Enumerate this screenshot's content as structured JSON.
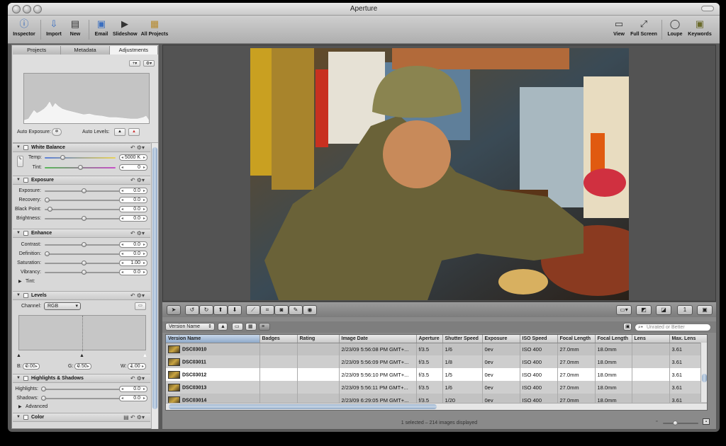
{
  "window": {
    "title": "Aperture"
  },
  "toolbar": {
    "inspector": "Inspector",
    "import": "Import",
    "new": "New",
    "email": "Email",
    "slideshow": "Slideshow",
    "all_projects": "All Projects",
    "view": "View",
    "full_screen": "Full Screen",
    "loupe": "Loupe",
    "keywords": "Keywords"
  },
  "inspector": {
    "tabs": [
      "Projects",
      "Metadata",
      "Adjustments"
    ],
    "active_tab": "Adjustments",
    "auto_exposure": "Auto Exposure:",
    "auto_levels": "Auto Levels:",
    "white_balance": {
      "title": "White Balance",
      "temp_label": "Temp:",
      "temp_value": "5000 K",
      "tint_label": "Tint:",
      "tint_value": "0"
    },
    "exposure": {
      "title": "Exposure",
      "rows": [
        {
          "label": "Exposure:",
          "value": "0.0"
        },
        {
          "label": "Recovery:",
          "value": "0.0"
        },
        {
          "label": "Black Point:",
          "value": "0.0"
        },
        {
          "label": "Brightness:",
          "value": "0.0"
        }
      ]
    },
    "enhance": {
      "title": "Enhance",
      "rows": [
        {
          "label": "Contrast:",
          "value": "0.0"
        },
        {
          "label": "Definition:",
          "value": "0.0"
        },
        {
          "label": "Saturation:",
          "value": "1.00"
        },
        {
          "label": "Vibrancy:",
          "value": "0.0"
        }
      ],
      "tint_label": "Tint:"
    },
    "levels": {
      "title": "Levels",
      "channel_label": "Channel:",
      "channel_value": "RGB",
      "b_label": "B:",
      "b_value": "0.00",
      "g_label": "G:",
      "g_value": "0.50",
      "w_label": "W:",
      "w_value": "1.00"
    },
    "highlights_shadows": {
      "title": "Highlights & Shadows",
      "highlights_label": "Highlights:",
      "highlights_value": "0.0",
      "shadows_label": "Shadows:",
      "shadows_value": "0.0",
      "advanced_label": "Advanced"
    },
    "color": {
      "title": "Color"
    }
  },
  "browser": {
    "sort_popup": "Version Name",
    "search_placeholder": "Unrated or Better",
    "columns": [
      "Version Name",
      "Badges",
      "Rating",
      "Image Date",
      "Aperture",
      "Shutter Speed",
      "Exposure",
      "ISO Speed",
      "Focal Length",
      "Focal Length",
      "Lens",
      "Max. Lens"
    ],
    "rows": [
      {
        "name": "DSC03010",
        "badges": "",
        "rating": "",
        "date": "2/23/09 5:56:08 PM GMT+...",
        "aperture": "f/3.5",
        "shutter": "1/6",
        "exposure": "0ev",
        "iso": "ISO 400",
        "focal": "27.0mm",
        "focal2": "18.0mm",
        "lens": "",
        "maxlens": "3.61"
      },
      {
        "name": "DSC03011",
        "badges": "",
        "rating": "",
        "date": "2/23/09 5:56:09 PM GMT+...",
        "aperture": "f/3.5",
        "shutter": "1/8",
        "exposure": "0ev",
        "iso": "ISO 400",
        "focal": "27.0mm",
        "focal2": "18.0mm",
        "lens": "",
        "maxlens": "3.61"
      },
      {
        "name": "DSC03012",
        "badges": "",
        "rating": "",
        "date": "2/23/09 5:56:10 PM GMT+...",
        "aperture": "f/3.5",
        "shutter": "1/5",
        "exposure": "0ev",
        "iso": "ISO 400",
        "focal": "27.0mm",
        "focal2": "18.0mm",
        "lens": "",
        "maxlens": "3.61"
      },
      {
        "name": "DSC03013",
        "badges": "",
        "rating": "",
        "date": "2/23/09 5:56:11 PM GMT+...",
        "aperture": "f/3.5",
        "shutter": "1/6",
        "exposure": "0ev",
        "iso": "ISO 400",
        "focal": "27.0mm",
        "focal2": "18.0mm",
        "lens": "",
        "maxlens": "3.61"
      },
      {
        "name": "DSC03014",
        "badges": "",
        "rating": "",
        "date": "2/23/09 6:29:05 PM GMT+...",
        "aperture": "f/3.5",
        "shutter": "1/20",
        "exposure": "0ev",
        "iso": "ISO 400",
        "focal": "27.0mm",
        "focal2": "18.0mm",
        "lens": "",
        "maxlens": "3.61"
      }
    ],
    "selected_row": 2,
    "status": "1 selected – 214 images displayed"
  },
  "colors": {
    "selection_blue": "#8ea9c9",
    "window_gray": "#5a5a5a"
  }
}
